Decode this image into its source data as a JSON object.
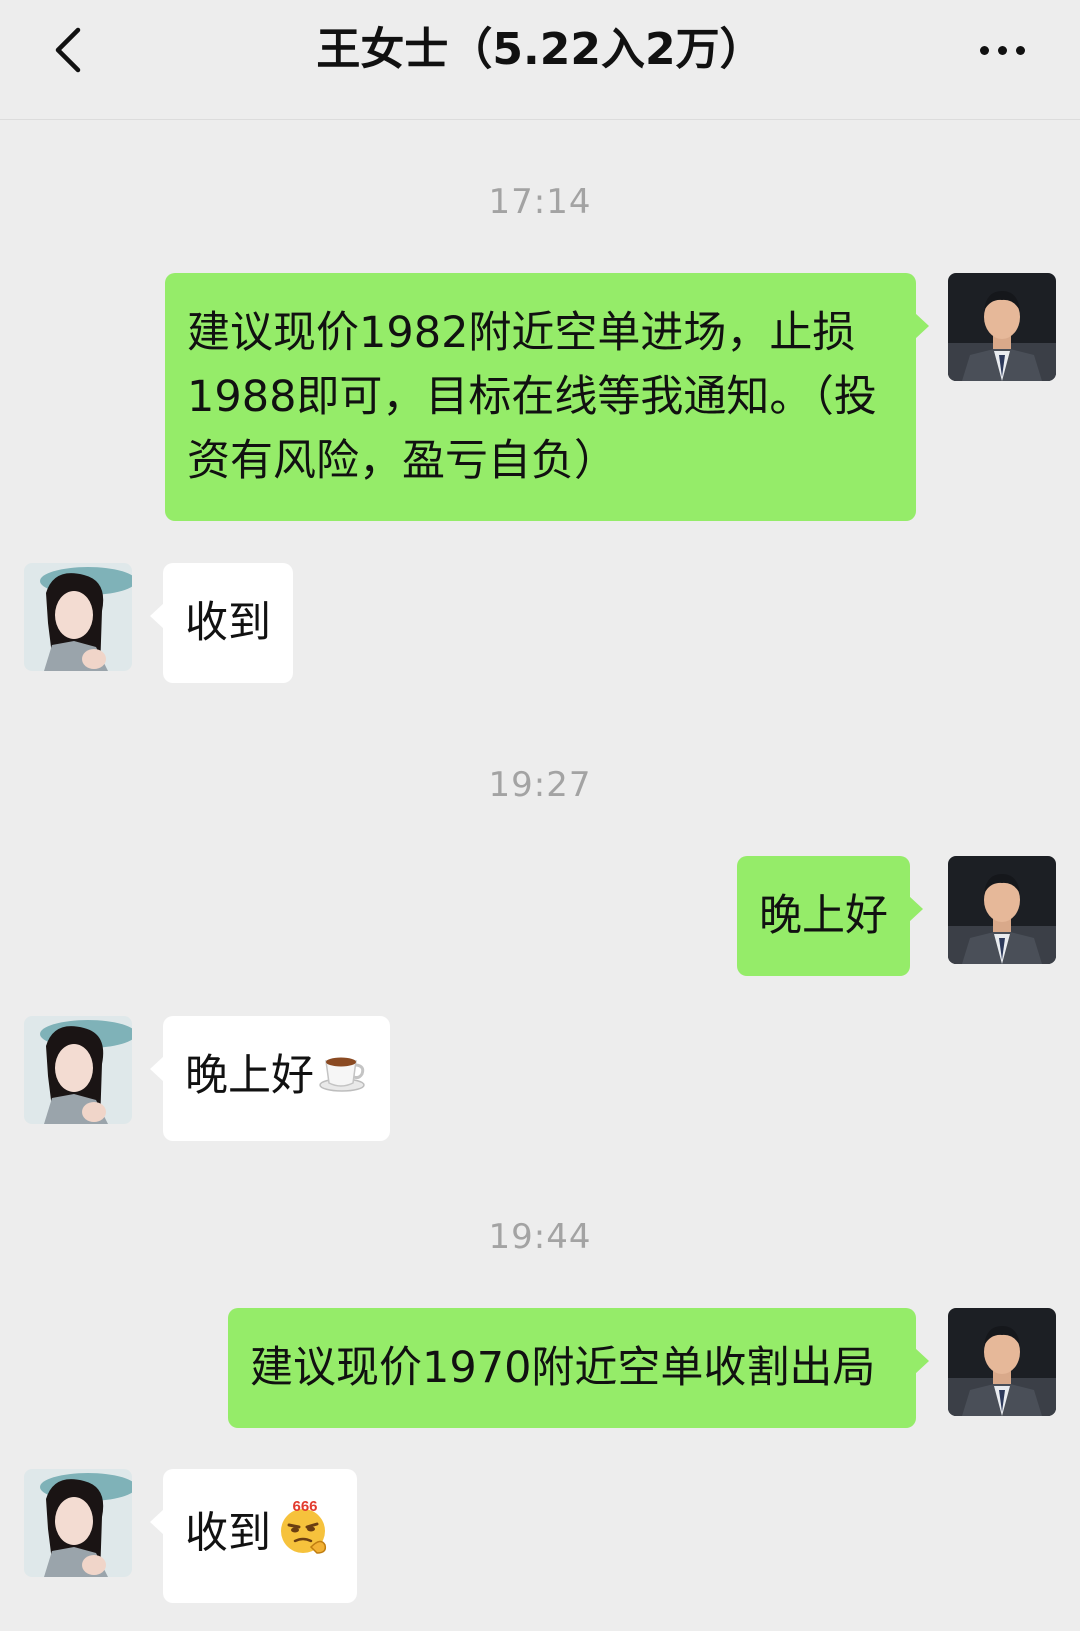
{
  "header": {
    "title": "王女士（5.22入2万）",
    "back_icon": "chevron-left-icon",
    "more_icon": "ellipsis-icon"
  },
  "colors": {
    "background": "#ededed",
    "outgoing_bubble": "#95ec69",
    "incoming_bubble": "#ffffff",
    "timestamp": "#a3a3a3"
  },
  "timestamps": [
    "17:14",
    "19:27",
    "19:44"
  ],
  "messages": [
    {
      "from": "me",
      "text": "建议现价1982附近空单进场，止损1988即可，目标在线等我通知。（投资有风险，盈亏自负）"
    },
    {
      "from": "contact",
      "text": "收到"
    },
    {
      "from": "me",
      "text": "晚上好"
    },
    {
      "from": "contact",
      "text": "晚上好",
      "emoji": "coffee-emoji"
    },
    {
      "from": "me",
      "text": "建议现价1970附近空单收割出局"
    },
    {
      "from": "contact",
      "text": "收到",
      "emoji": "666-emoji"
    }
  ]
}
